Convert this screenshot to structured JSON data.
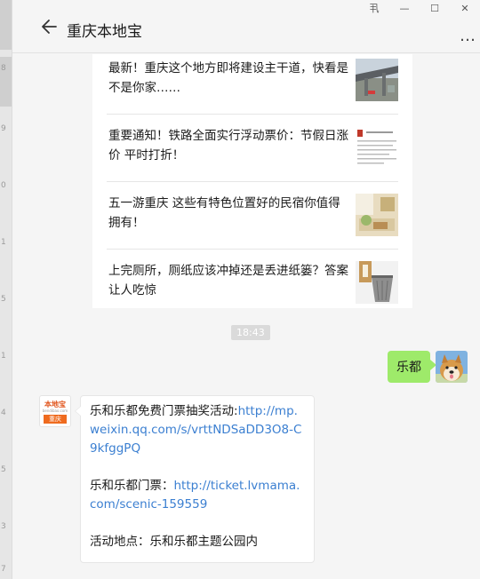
{
  "window": {
    "title": "重庆本地宝",
    "controls": {
      "pin": "丮",
      "minimize": "—",
      "maximize": "☐",
      "close": "✕"
    },
    "more": "…"
  },
  "left_strip": {
    "numbers": [
      "8",
      "9",
      "0",
      "1",
      "5",
      "1",
      "4",
      "5",
      "3",
      "7"
    ]
  },
  "articles": [
    {
      "title": "最新！重庆这个地方即将建设主干道，快看是不是你家……",
      "thumb": "overpass-photo"
    },
    {
      "title": "重要通知！铁路全面实行浮动票价：节假日涨价 平时打折！",
      "thumb": "document-photo"
    },
    {
      "title": "五一游重庆 这些有特色位置好的民宿你值得拥有！",
      "thumb": "guesthouse-photo"
    },
    {
      "title": "上完厕所，厕纸应该冲掉还是丢进纸篓？答案让人吃惊",
      "thumb": "wastebasket-photo"
    }
  ],
  "time_badge": "18:43",
  "my_message": "乐都",
  "their_avatar": {
    "logo": "本地宝",
    "sub": "bendibao.com",
    "city": "重庆"
  },
  "their_message": {
    "line1_prefix": "乐和乐都免费门票抽奖活动:",
    "line1_link": "http://mp.weixin.qq.com/s/vrttNDSaDD3O8-C9kfggPQ",
    "line2_prefix": "乐和乐都门票：",
    "line2_link": "http://ticket.lvmama.com/scenic-159559",
    "line3": "活动地点：乐和乐都主题公园内"
  },
  "colors": {
    "bubble_green": "#9eea6a",
    "link": "#3b7fd1",
    "chat_bg": "#f5f5f5"
  }
}
